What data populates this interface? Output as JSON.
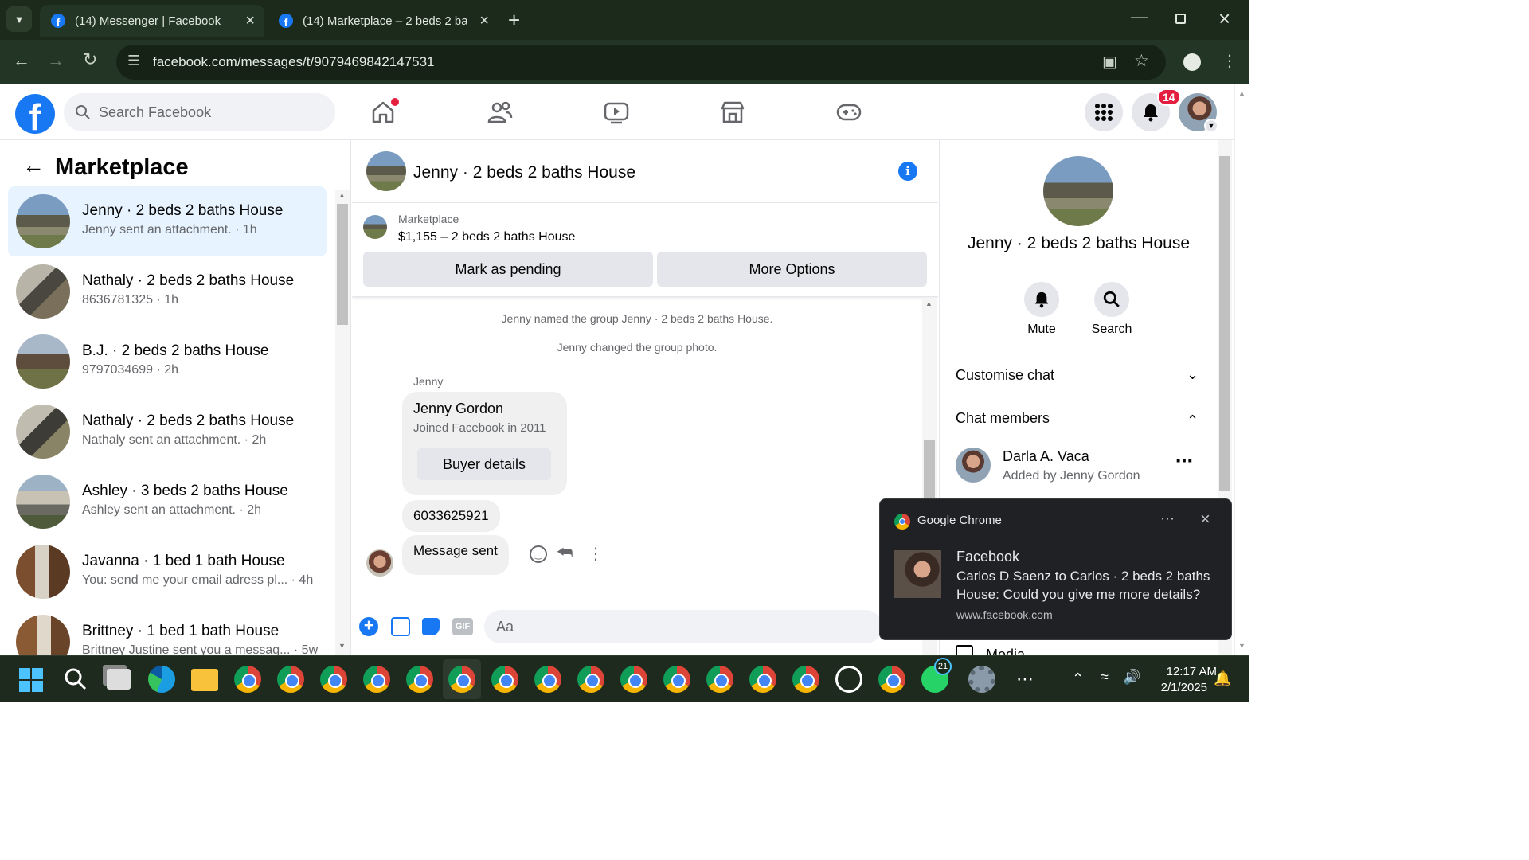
{
  "browser": {
    "tabs": [
      {
        "title": "(14) Messenger | Facebook"
      },
      {
        "title": "(14) Marketplace – 2 beds 2 bat"
      }
    ],
    "url": "facebook.com/messages/t/9079469842147531"
  },
  "fb": {
    "search_placeholder": "Search Facebook",
    "notification_count": "14"
  },
  "left": {
    "title": "Marketplace",
    "conversations": [
      {
        "name": "Jenny · 2 beds 2 baths House",
        "sub": "Jenny sent an attachment. · 1h"
      },
      {
        "name": "Nathaly · 2 beds 2 baths House",
        "sub": "8636781325 · 1h"
      },
      {
        "name": "B.J. · 2 beds 2 baths House",
        "sub": "9797034699 · 2h"
      },
      {
        "name": "Nathaly · 2 beds 2 baths House",
        "sub": "Nathaly sent an attachment. · 2h"
      },
      {
        "name": "Ashley · 3 beds 2 baths House",
        "sub": "Ashley sent an attachment. · 2h"
      },
      {
        "name": "Javanna · 1 bed 1 bath House",
        "sub": "You: send me your email adress pl... · 4h"
      },
      {
        "name": "Brittney · 1 bed 1 bath House",
        "sub": "Brittney Justine sent you a messag... · 5w"
      }
    ]
  },
  "chat": {
    "title": "Jenny · 2 beds 2 baths House",
    "listing_label": "Marketplace",
    "listing_text": "$1,155 – 2 beds 2 baths House",
    "mark_pending": "Mark as pending",
    "more_options": "More Options",
    "events": [
      "Jenny named the group Jenny · 2 beds 2 baths House.",
      "Jenny changed the group photo."
    ],
    "sender": "Jenny",
    "card_name": "Jenny Gordon",
    "card_sub": "Joined Facebook in 2011",
    "buyer_details": "Buyer details",
    "msg_phone": "6033625921",
    "msg_sent": "Message sent",
    "composer_placeholder": "Aa"
  },
  "right": {
    "title": "Jenny · 2 beds 2 baths House",
    "mute": "Mute",
    "search": "Search",
    "customise": "Customise chat",
    "members": "Chat members",
    "member_name": "Darla A. Vaca",
    "member_sub": "Added by Jenny Gordon",
    "media": "Media"
  },
  "notification": {
    "app": "Google Chrome",
    "title": "Facebook",
    "body": "Carlos D Saenz to Carlos · 2 beds 2 baths House: Could you give me more details?",
    "source": "www.facebook.com"
  },
  "taskbar": {
    "whatsapp_badge": "21",
    "time": "12:17 AM",
    "date": "2/1/2025"
  },
  "colors": {
    "fb_blue": "#1877f2",
    "badge_red": "#e41e3f",
    "selected_row": "#e7f3ff"
  }
}
